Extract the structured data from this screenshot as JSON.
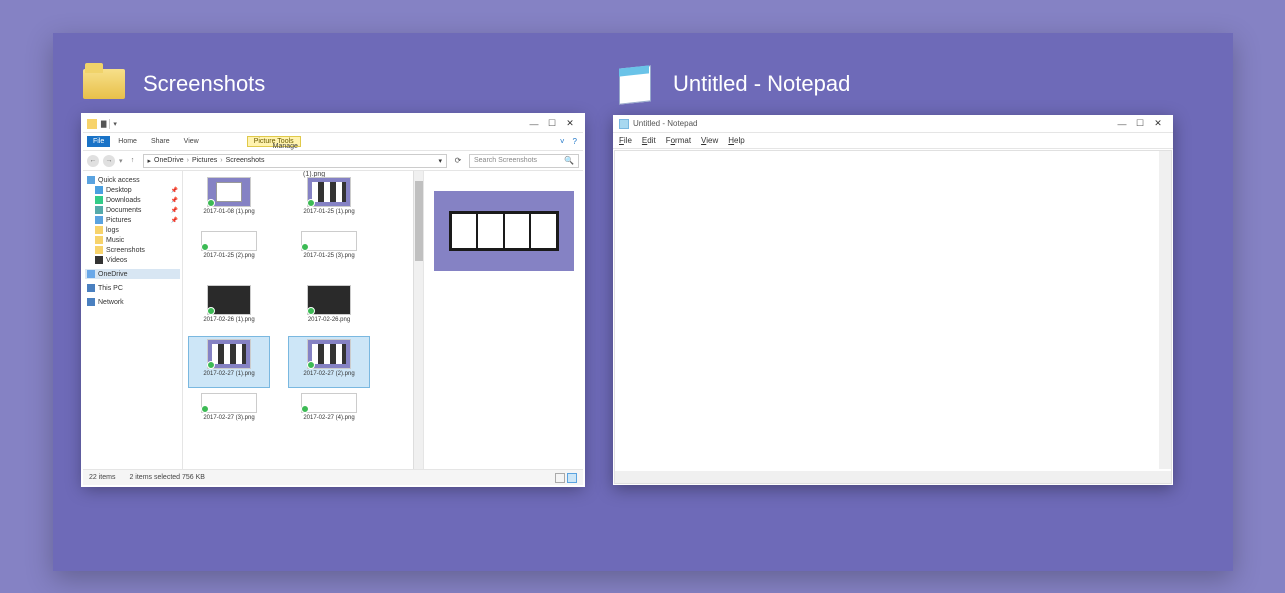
{
  "taskview": {
    "cards": [
      {
        "title": "Screenshots",
        "icon": "folder"
      },
      {
        "title": "Untitled - Notepad",
        "icon": "notepad"
      }
    ]
  },
  "explorer": {
    "ribbon": {
      "file": "File",
      "home": "Home",
      "share": "Share",
      "view": "View",
      "manage": "Manage",
      "context": "Picture Tools"
    },
    "breadcrumb": [
      "OneDrive",
      "Pictures",
      "Screenshots"
    ],
    "search_placeholder": "Search Screenshots",
    "column_header": "(1).png",
    "nav": {
      "quick": "Quick access",
      "items": [
        {
          "label": "Desktop",
          "pinned": true,
          "ico": "blue"
        },
        {
          "label": "Downloads",
          "pinned": true,
          "ico": "dl"
        },
        {
          "label": "Documents",
          "pinned": true,
          "ico": "doc"
        },
        {
          "label": "Pictures",
          "pinned": true,
          "ico": "pic"
        },
        {
          "label": "logs",
          "pinned": false,
          "ico": "fld"
        },
        {
          "label": "Music",
          "pinned": false,
          "ico": "mus"
        },
        {
          "label": "Screenshots",
          "pinned": false,
          "ico": "fld"
        },
        {
          "label": "Videos",
          "pinned": false,
          "ico": "vid"
        }
      ],
      "onedrive": "OneDrive",
      "thispc": "This PC",
      "network": "Network"
    },
    "files": [
      {
        "name": "2017-01-08 (1).png",
        "sel": false,
        "style": "doc"
      },
      {
        "name": "2017-01-25 (1).png",
        "sel": false,
        "style": "bars"
      },
      {
        "name": "2017-01-25 (2).png",
        "sel": false,
        "style": "wide"
      },
      {
        "name": "2017-01-25 (3).png",
        "sel": false,
        "style": "wide"
      },
      {
        "name": "2017-02-26 (1).png",
        "sel": false,
        "style": "dark"
      },
      {
        "name": "2017-02-26.png",
        "sel": false,
        "style": "dark"
      },
      {
        "name": "2017-02-27 (1).png",
        "sel": true,
        "style": "bars"
      },
      {
        "name": "2017-02-27 (2).png",
        "sel": true,
        "style": "bars"
      },
      {
        "name": "2017-02-27 (3).png",
        "sel": false,
        "style": "wide"
      },
      {
        "name": "2017-02-27 (4).png",
        "sel": false,
        "style": "wide"
      }
    ],
    "status": {
      "count": "22 items",
      "selection": "2 items selected  756 KB"
    }
  },
  "notepad": {
    "title": "Untitled - Notepad",
    "menu": {
      "file": "File",
      "edit": "Edit",
      "format": "Format",
      "view": "View",
      "help": "Help"
    }
  }
}
